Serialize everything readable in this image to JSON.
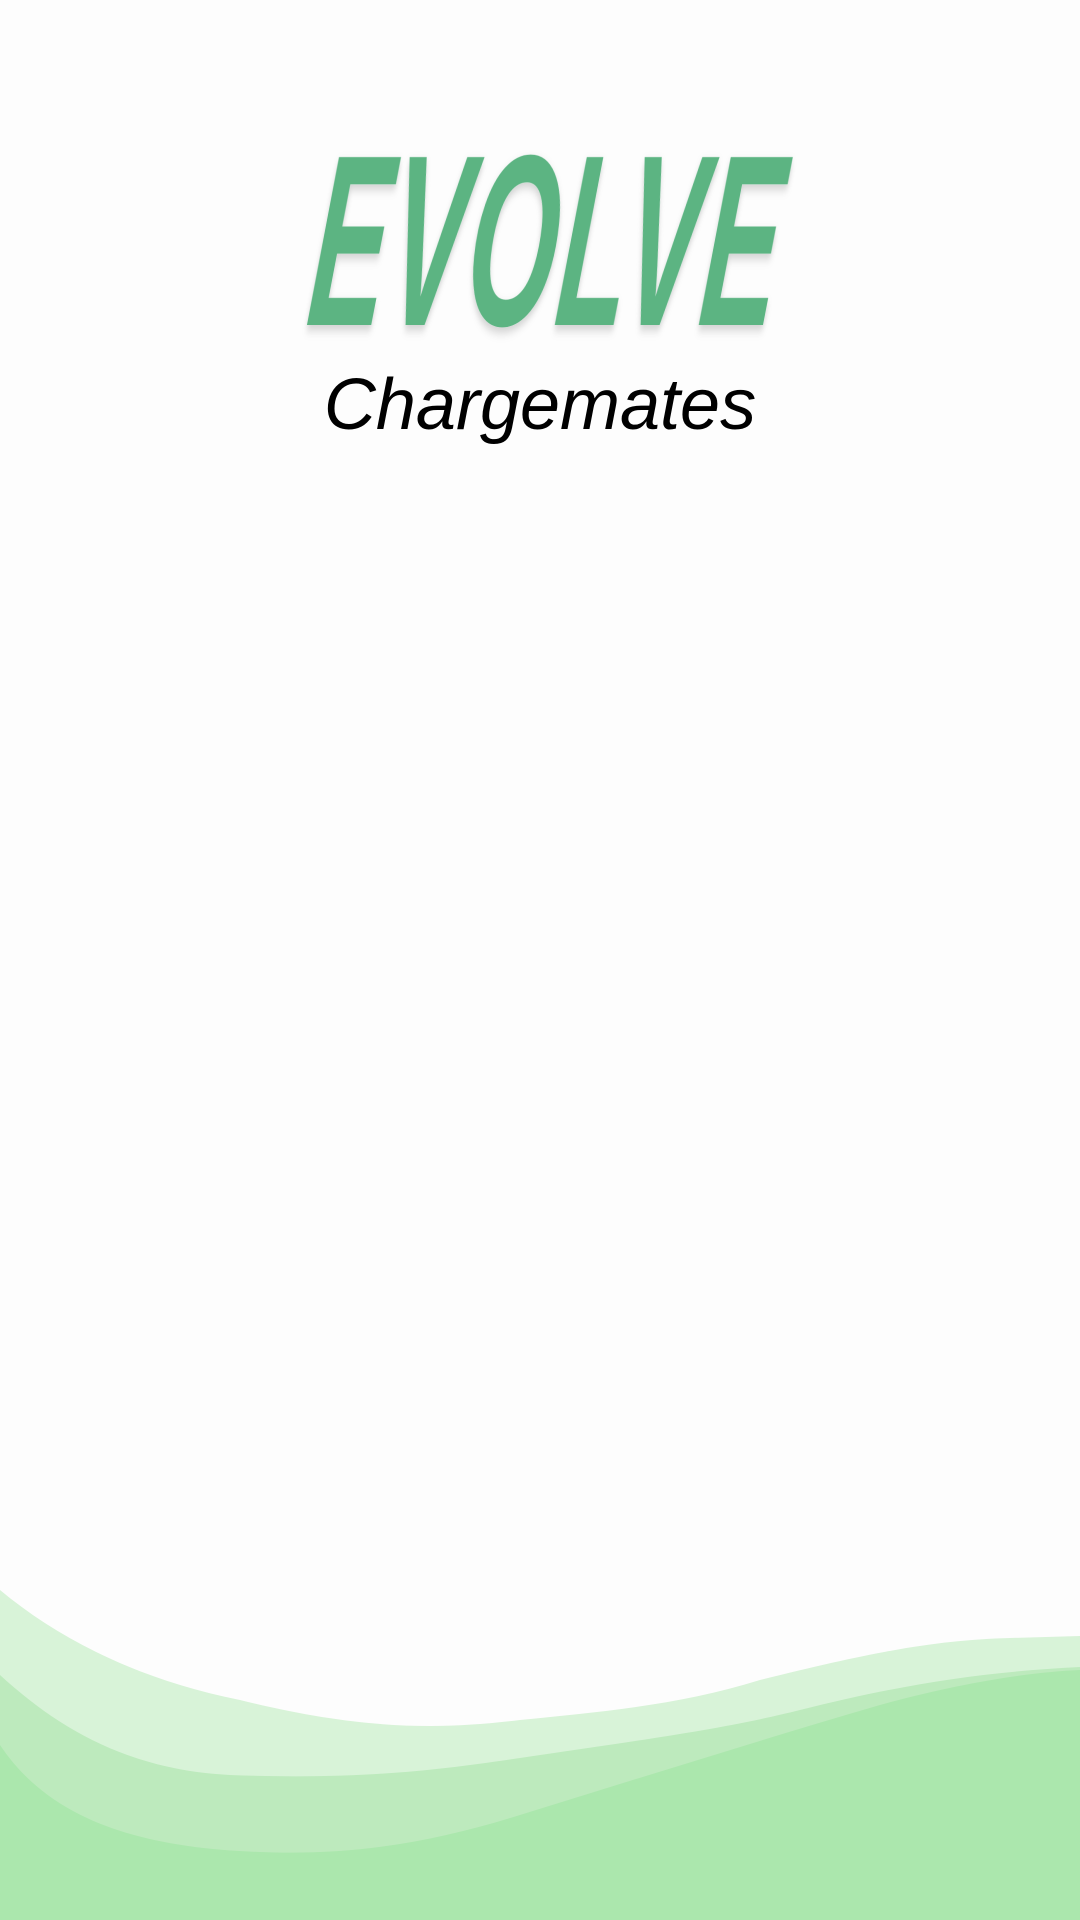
{
  "brand": {
    "logo_text": "EVOLVE",
    "subtitle": "Chargemates"
  },
  "colors": {
    "background": "#fdfdfd",
    "logo_green": "#5cb482",
    "subtitle": "#000000",
    "wave_light": "#d8f3d8",
    "wave_mid": "#bdeabd",
    "wave_dark": "#abe7ad"
  },
  "decoration": {
    "icon": "wave-background-icon"
  }
}
